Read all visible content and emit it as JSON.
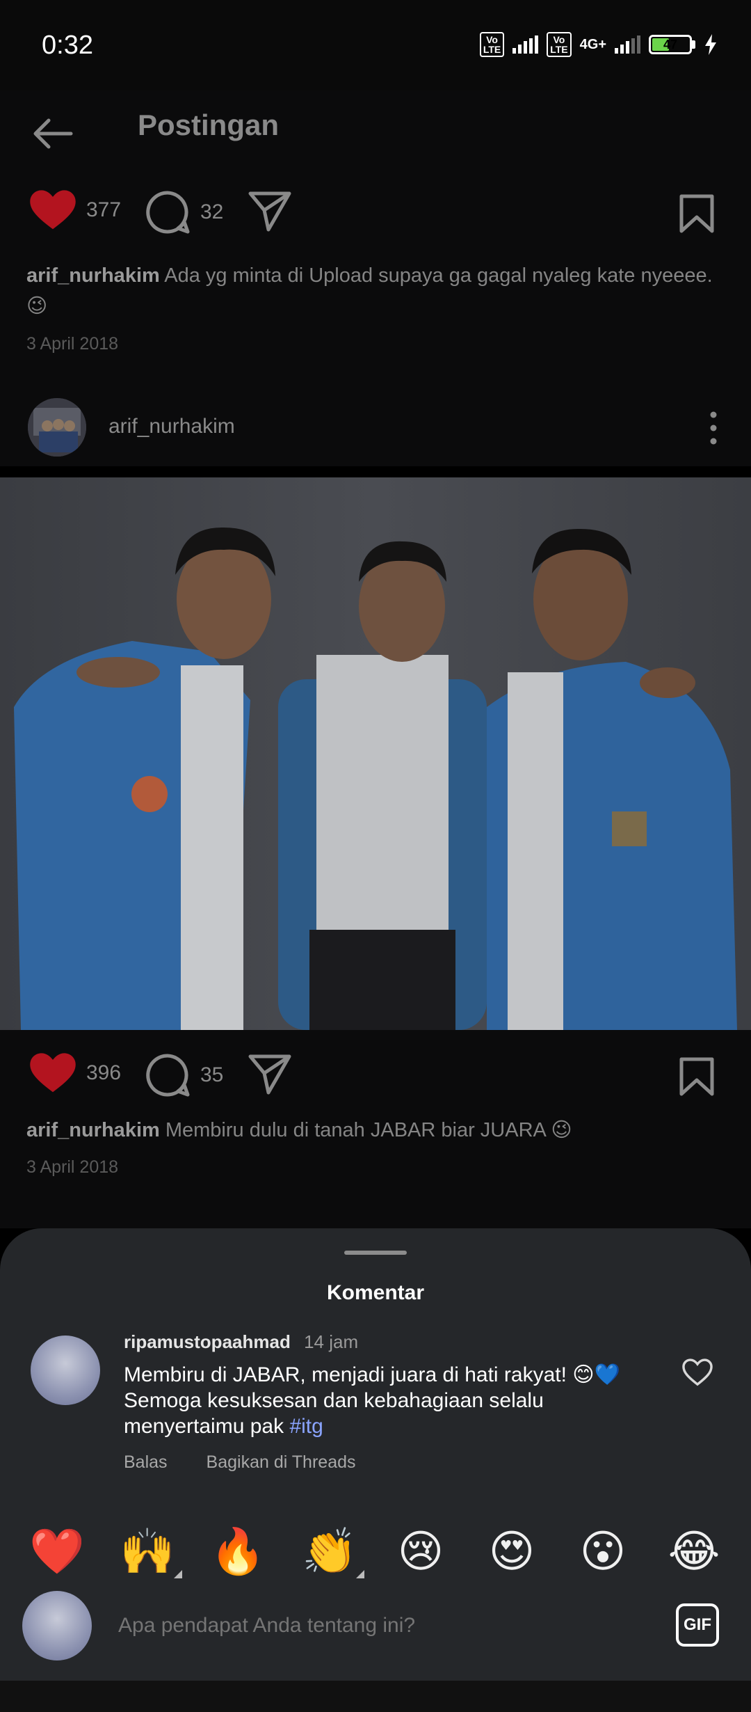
{
  "status": {
    "time": "0:32",
    "volte1": "Vo LTE",
    "volte2": "Vo LTE",
    "network": "4G+",
    "battery": "47",
    "battery_level": 0.47
  },
  "header": {
    "title": "Postingan",
    "back_icon": "arrow-left-icon"
  },
  "post1": {
    "likes": "377",
    "comments": "32",
    "caption_user": "arif_nurhakim",
    "caption_text": "Ada yg minta di Upload supaya ga gagal nyaleg kate nyeeee. 😉",
    "date": "3 April 2018"
  },
  "post2": {
    "author": "arif_nurhakim",
    "likes": "396",
    "comments": "35",
    "caption_user": "arif_nurhakim",
    "caption_text": "Membiru dulu di tanah JABAR biar JUARA 😉",
    "date": "3 April 2018"
  },
  "sheet": {
    "title": "Komentar",
    "comment": {
      "user": "ripamustopaahmad",
      "time": "14 jam",
      "text_main": "Membiru di JABAR, menjadi juara di hati rakyat! 😊💙 Semoga kesuksesan dan kebahagiaan selalu menyertaimu pak ",
      "hashtag": "#itg",
      "reply": "Balas",
      "share": "Bagikan di Threads"
    },
    "emojis": [
      "❤️",
      "🙌",
      "🔥",
      "👏",
      "😢",
      "😍",
      "😮",
      "😂"
    ],
    "input_placeholder": "Apa pendapat Anda tentang ini?",
    "gif_label": "GIF"
  },
  "colors": {
    "like_red": "#b3141f",
    "sheet_bg": "#25272a",
    "hashtag": "#8aa4ff",
    "jacket_blue": "#2f5f8e"
  }
}
